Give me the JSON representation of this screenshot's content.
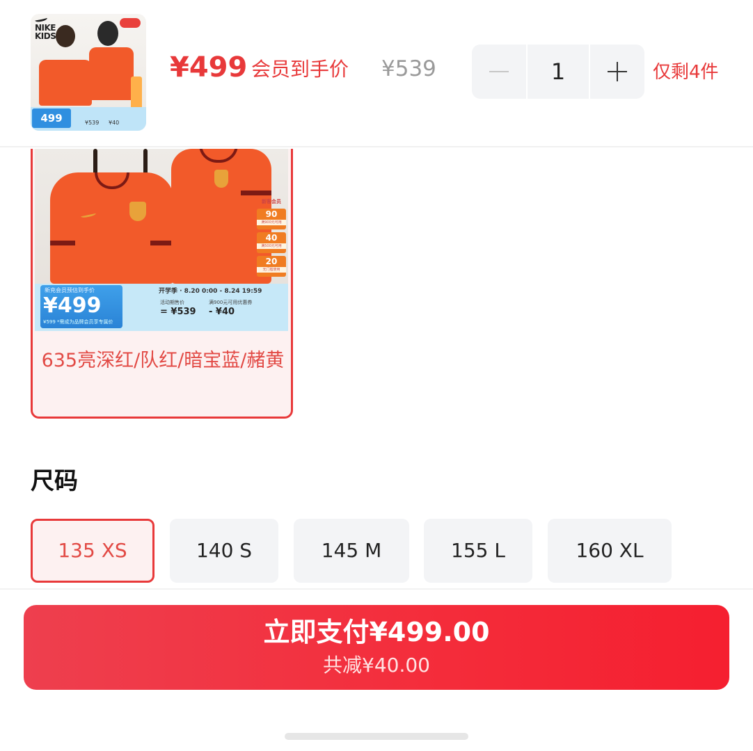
{
  "header": {
    "price": "¥499",
    "price_label": "会员到手价",
    "original_price": "¥539",
    "quantity": "1",
    "stock": "仅剩4件",
    "thumbnail": {
      "logo": "NIKE KIDS",
      "price": "499",
      "price_line_1": "¥539",
      "price_line_2": "¥40"
    }
  },
  "color_option": {
    "name": "635亮深红/队红/暗宝蓝/赭黄",
    "image": {
      "price_tag_top": "新充会员预估到手价",
      "price": "¥499",
      "price_tag_bottom": "¥599  *需成为品牌会员享专属价",
      "sale_line": "开学季 · 8.20 0:00 - 8.24 19:59",
      "col1_caption": "活动期售价",
      "col1_value": "= ¥539",
      "col2_caption": "满900元可用优惠券",
      "col2_value": "- ¥40",
      "promo_header": "新客会员",
      "promo_tags": [
        {
          "value": "90",
          "note": "满900元可用"
        },
        {
          "value": "40",
          "note": "满500元可用"
        },
        {
          "value": "20",
          "note": "无门槛使用"
        }
      ]
    }
  },
  "size": {
    "title": "尺码",
    "options": [
      "135 XS",
      "140 S",
      "145 M",
      "155 L",
      "160 XL"
    ],
    "selected": "135 XS"
  },
  "pay": {
    "label": "立即支付¥499.00",
    "discount": "共减¥40.00"
  },
  "colors": {
    "accent": "#e8393a",
    "pay_button": "#f42c3a",
    "option_bg": "#f3f4f6"
  }
}
